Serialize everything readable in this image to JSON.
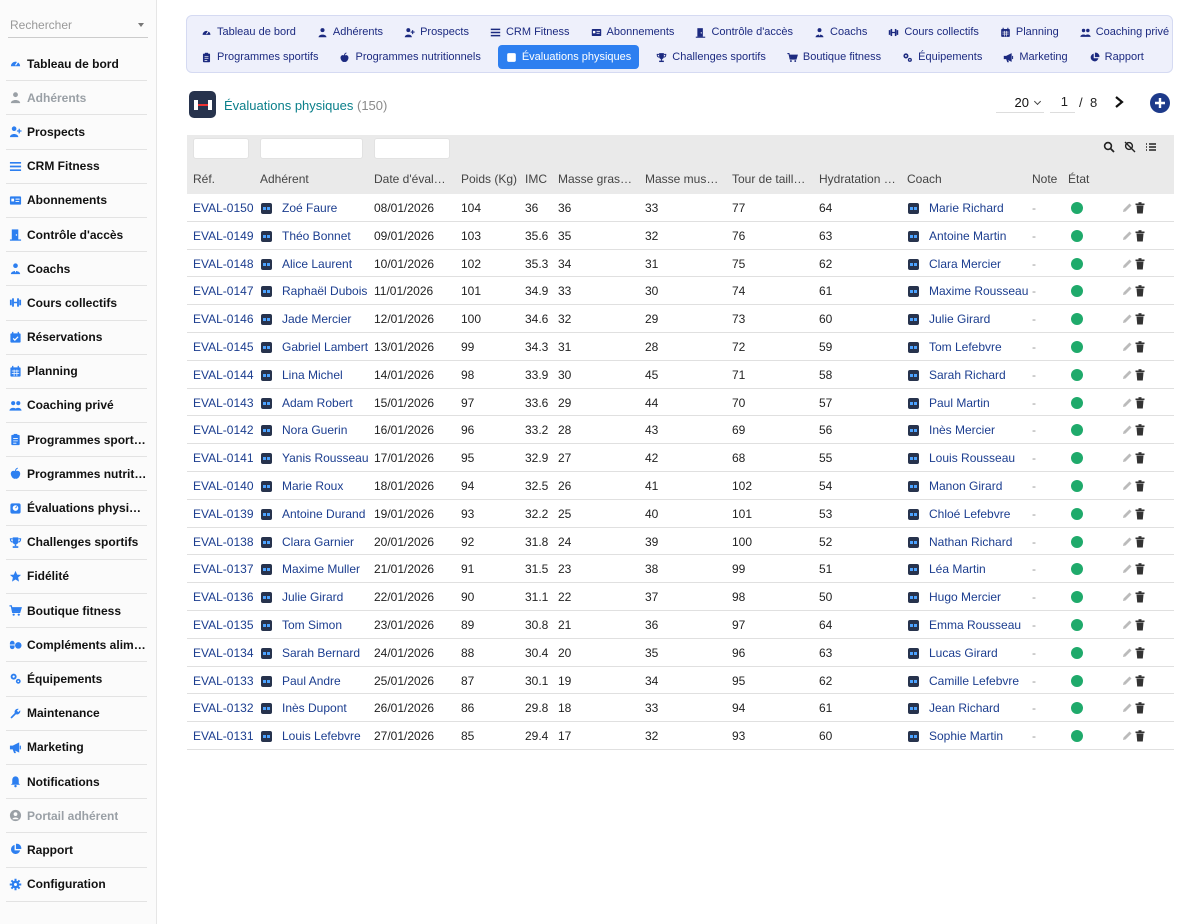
{
  "sidebar": {
    "search_placeholder": "Rechercher",
    "items": [
      {
        "label": "Tableau de bord",
        "icon": "dashboard-icon",
        "disabled": false
      },
      {
        "label": "Adhérents",
        "icon": "user-icon",
        "disabled": true
      },
      {
        "label": "Prospects",
        "icon": "user-plus-icon",
        "disabled": false
      },
      {
        "label": "CRM Fitness",
        "icon": "list-icon",
        "disabled": false
      },
      {
        "label": "Abonnements",
        "icon": "id-card-icon",
        "disabled": false
      },
      {
        "label": "Contrôle d'accès",
        "icon": "door-icon",
        "disabled": false
      },
      {
        "label": "Coachs",
        "icon": "coach-icon",
        "disabled": false
      },
      {
        "label": "Cours collectifs",
        "icon": "dumbbell-icon",
        "disabled": false
      },
      {
        "label": "Réservations",
        "icon": "calendar-check-icon",
        "disabled": false
      },
      {
        "label": "Planning",
        "icon": "calendar-icon",
        "disabled": false
      },
      {
        "label": "Coaching privé",
        "icon": "users-icon",
        "disabled": false
      },
      {
        "label": "Programmes sportifs",
        "icon": "clipboard-icon",
        "disabled": false
      },
      {
        "label": "Programmes nutritionnels",
        "icon": "apple-icon",
        "disabled": false
      },
      {
        "label": "Évaluations physiques",
        "icon": "scale-icon",
        "disabled": false
      },
      {
        "label": "Challenges sportifs",
        "icon": "trophy-icon",
        "disabled": false
      },
      {
        "label": "Fidélité",
        "icon": "star-icon",
        "disabled": false
      },
      {
        "label": "Boutique fitness",
        "icon": "cart-icon",
        "disabled": false
      },
      {
        "label": "Compléments alimentaires",
        "icon": "pills-icon",
        "disabled": false
      },
      {
        "label": "Équipements",
        "icon": "cogs-icon",
        "disabled": false
      },
      {
        "label": "Maintenance",
        "icon": "wrench-icon",
        "disabled": false
      },
      {
        "label": "Marketing",
        "icon": "megaphone-icon",
        "disabled": false
      },
      {
        "label": "Notifications",
        "icon": "bell-icon",
        "disabled": false
      },
      {
        "label": "Portail adhérent",
        "icon": "user-circle-icon",
        "disabled": true
      },
      {
        "label": "Rapport",
        "icon": "pie-chart-icon",
        "disabled": false
      },
      {
        "label": "Configuration",
        "icon": "gear-icon",
        "disabled": false
      }
    ]
  },
  "topnav": {
    "row1": [
      {
        "label": "Tableau de bord",
        "icon": "dashboard-icon"
      },
      {
        "label": "Adhérents",
        "icon": "user-icon"
      },
      {
        "label": "Prospects",
        "icon": "user-plus-icon"
      },
      {
        "label": "CRM Fitness",
        "icon": "list-icon"
      },
      {
        "label": "Abonnements",
        "icon": "id-card-icon"
      },
      {
        "label": "Contrôle d'accès",
        "icon": "door-icon"
      },
      {
        "label": "Coachs",
        "icon": "coach-icon"
      },
      {
        "label": "Cours collectifs",
        "icon": "dumbbell-icon"
      },
      {
        "label": "Planning",
        "icon": "calendar-icon"
      },
      {
        "label": "Coaching privé",
        "icon": "users-icon"
      }
    ],
    "row2": [
      {
        "label": "Programmes sportifs",
        "icon": "clipboard-icon",
        "active": false
      },
      {
        "label": "Programmes nutritionnels",
        "icon": "apple-icon",
        "active": false
      },
      {
        "label": "Évaluations physiques",
        "icon": "scale-icon",
        "active": true
      },
      {
        "label": "Challenges sportifs",
        "icon": "trophy-icon",
        "active": false
      },
      {
        "label": "Boutique fitness",
        "icon": "cart-icon",
        "active": false
      },
      {
        "label": "Équipements",
        "icon": "cogs-icon",
        "active": false
      },
      {
        "label": "Marketing",
        "icon": "megaphone-icon",
        "active": false
      },
      {
        "label": "Rapport",
        "icon": "pie-chart-icon",
        "active": false
      }
    ]
  },
  "header": {
    "title": "Évaluations physiques",
    "count": "(150)",
    "page_size": "20",
    "page": "1",
    "separator": "/",
    "total_pages": "8"
  },
  "colors": {
    "accent": "#2d7ff0",
    "title": "#0a7f8a",
    "link": "#1b3d8f",
    "state_ok": "#1faa6b"
  },
  "table": {
    "columns": [
      "Réf.",
      "Adhérent",
      "Date d'évaluation",
      "Poids (Kg)",
      "IMC",
      "Masse grasse (%)",
      "Masse musculaire (%)",
      "Tour de taille (cm)",
      "Hydratation (%)",
      "Coach",
      "Note",
      "État"
    ],
    "rows": [
      {
        "ref": "EVAL-0150",
        "member": "Zoé Faure",
        "date": "08/01/2026",
        "weight": "104",
        "imc": "36",
        "fat": "36",
        "muscle": "33",
        "waist": "77",
        "hydration": "64",
        "coach": "Marie Richard",
        "note": "-"
      },
      {
        "ref": "EVAL-0149",
        "member": "Théo Bonnet",
        "date": "09/01/2026",
        "weight": "103",
        "imc": "35.6",
        "fat": "35",
        "muscle": "32",
        "waist": "76",
        "hydration": "63",
        "coach": "Antoine Martin",
        "note": "-"
      },
      {
        "ref": "EVAL-0148",
        "member": "Alice Laurent",
        "date": "10/01/2026",
        "weight": "102",
        "imc": "35.3",
        "fat": "34",
        "muscle": "31",
        "waist": "75",
        "hydration": "62",
        "coach": "Clara Mercier",
        "note": "-"
      },
      {
        "ref": "EVAL-0147",
        "member": "Raphaël Dubois",
        "date": "11/01/2026",
        "weight": "101",
        "imc": "34.9",
        "fat": "33",
        "muscle": "30",
        "waist": "74",
        "hydration": "61",
        "coach": "Maxime Rousseau",
        "note": "-"
      },
      {
        "ref": "EVAL-0146",
        "member": "Jade Mercier",
        "date": "12/01/2026",
        "weight": "100",
        "imc": "34.6",
        "fat": "32",
        "muscle": "29",
        "waist": "73",
        "hydration": "60",
        "coach": "Julie Girard",
        "note": "-"
      },
      {
        "ref": "EVAL-0145",
        "member": "Gabriel Lambert",
        "date": "13/01/2026",
        "weight": "99",
        "imc": "34.3",
        "fat": "31",
        "muscle": "28",
        "waist": "72",
        "hydration": "59",
        "coach": "Tom Lefebvre",
        "note": "-"
      },
      {
        "ref": "EVAL-0144",
        "member": "Lina Michel",
        "date": "14/01/2026",
        "weight": "98",
        "imc": "33.9",
        "fat": "30",
        "muscle": "45",
        "waist": "71",
        "hydration": "58",
        "coach": "Sarah Richard",
        "note": "-"
      },
      {
        "ref": "EVAL-0143",
        "member": "Adam Robert",
        "date": "15/01/2026",
        "weight": "97",
        "imc": "33.6",
        "fat": "29",
        "muscle": "44",
        "waist": "70",
        "hydration": "57",
        "coach": "Paul Martin",
        "note": "-"
      },
      {
        "ref": "EVAL-0142",
        "member": "Nora Guerin",
        "date": "16/01/2026",
        "weight": "96",
        "imc": "33.2",
        "fat": "28",
        "muscle": "43",
        "waist": "69",
        "hydration": "56",
        "coach": "Inès Mercier",
        "note": "-"
      },
      {
        "ref": "EVAL-0141",
        "member": "Yanis Rousseau",
        "date": "17/01/2026",
        "weight": "95",
        "imc": "32.9",
        "fat": "27",
        "muscle": "42",
        "waist": "68",
        "hydration": "55",
        "coach": "Louis Rousseau",
        "note": "-"
      },
      {
        "ref": "EVAL-0140",
        "member": "Marie Roux",
        "date": "18/01/2026",
        "weight": "94",
        "imc": "32.5",
        "fat": "26",
        "muscle": "41",
        "waist": "102",
        "hydration": "54",
        "coach": "Manon Girard",
        "note": "-"
      },
      {
        "ref": "EVAL-0139",
        "member": "Antoine Durand",
        "date": "19/01/2026",
        "weight": "93",
        "imc": "32.2",
        "fat": "25",
        "muscle": "40",
        "waist": "101",
        "hydration": "53",
        "coach": "Chloé Lefebvre",
        "note": "-"
      },
      {
        "ref": "EVAL-0138",
        "member": "Clara Garnier",
        "date": "20/01/2026",
        "weight": "92",
        "imc": "31.8",
        "fat": "24",
        "muscle": "39",
        "waist": "100",
        "hydration": "52",
        "coach": "Nathan Richard",
        "note": "-"
      },
      {
        "ref": "EVAL-0137",
        "member": "Maxime Muller",
        "date": "21/01/2026",
        "weight": "91",
        "imc": "31.5",
        "fat": "23",
        "muscle": "38",
        "waist": "99",
        "hydration": "51",
        "coach": "Léa Martin",
        "note": "-"
      },
      {
        "ref": "EVAL-0136",
        "member": "Julie Girard",
        "date": "22/01/2026",
        "weight": "90",
        "imc": "31.1",
        "fat": "22",
        "muscle": "37",
        "waist": "98",
        "hydration": "50",
        "coach": "Hugo Mercier",
        "note": "-"
      },
      {
        "ref": "EVAL-0135",
        "member": "Tom Simon",
        "date": "23/01/2026",
        "weight": "89",
        "imc": "30.8",
        "fat": "21",
        "muscle": "36",
        "waist": "97",
        "hydration": "64",
        "coach": "Emma Rousseau",
        "note": "-"
      },
      {
        "ref": "EVAL-0134",
        "member": "Sarah Bernard",
        "date": "24/01/2026",
        "weight": "88",
        "imc": "30.4",
        "fat": "20",
        "muscle": "35",
        "waist": "96",
        "hydration": "63",
        "coach": "Lucas Girard",
        "note": "-"
      },
      {
        "ref": "EVAL-0133",
        "member": "Paul Andre",
        "date": "25/01/2026",
        "weight": "87",
        "imc": "30.1",
        "fat": "19",
        "muscle": "34",
        "waist": "95",
        "hydration": "62",
        "coach": "Camille Lefebvre",
        "note": "-"
      },
      {
        "ref": "EVAL-0132",
        "member": "Inès Dupont",
        "date": "26/01/2026",
        "weight": "86",
        "imc": "29.8",
        "fat": "18",
        "muscle": "33",
        "waist": "94",
        "hydration": "61",
        "coach": "Jean Richard",
        "note": "-"
      },
      {
        "ref": "EVAL-0131",
        "member": "Louis Lefebvre",
        "date": "27/01/2026",
        "weight": "85",
        "imc": "29.4",
        "fat": "17",
        "muscle": "32",
        "waist": "93",
        "hydration": "60",
        "coach": "Sophie Martin",
        "note": "-"
      }
    ]
  }
}
